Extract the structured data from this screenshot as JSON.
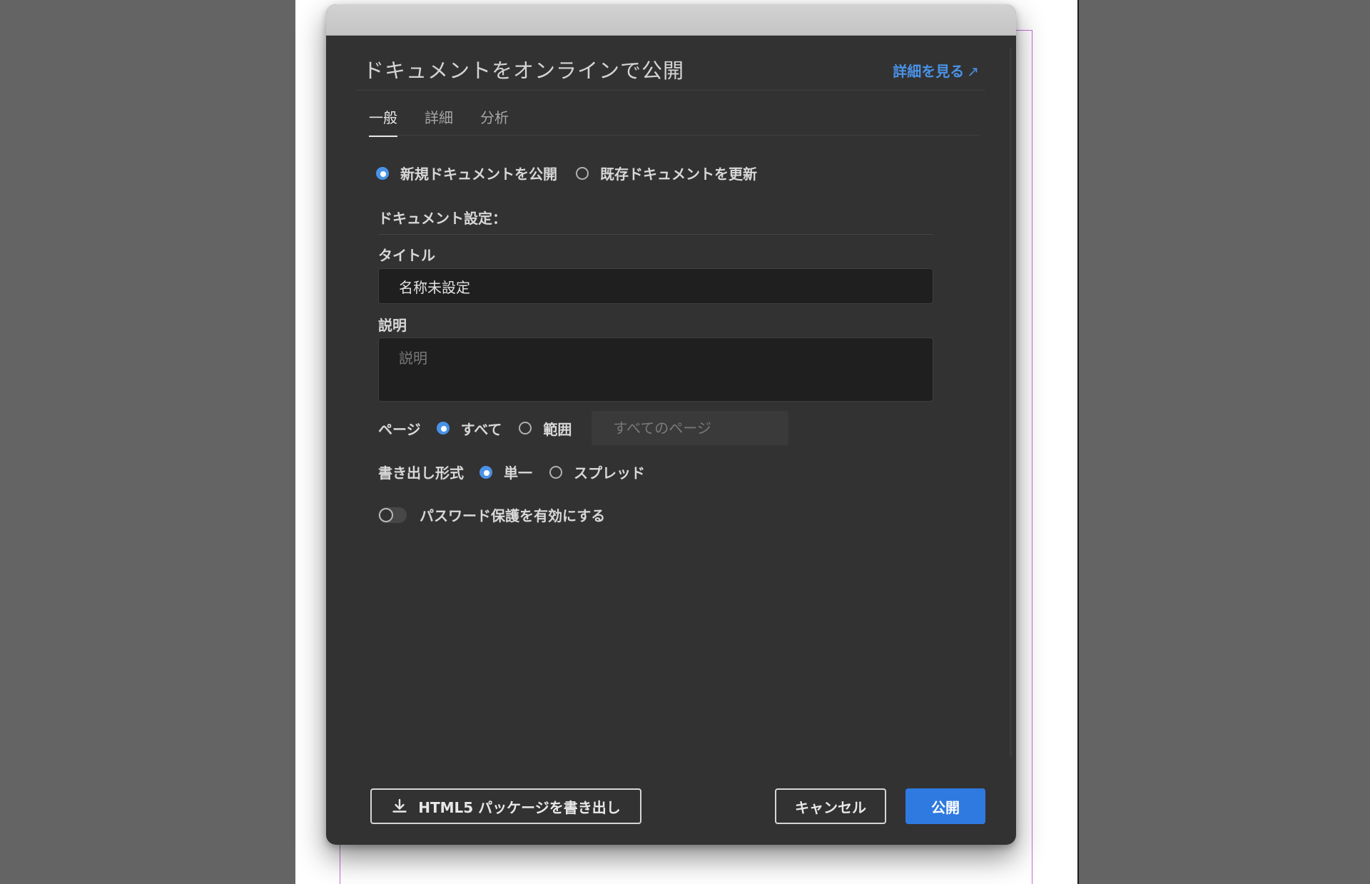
{
  "dialog": {
    "title": "ドキュメントをオンラインで公開",
    "learn_more": "詳細を見る",
    "learn_more_icon": "↗"
  },
  "tabs": [
    {
      "label": "一般",
      "active": true
    },
    {
      "label": "詳細",
      "active": false
    },
    {
      "label": "分析",
      "active": false
    }
  ],
  "publish_mode": {
    "options": [
      {
        "label": "新規ドキュメントを公開",
        "checked": true
      },
      {
        "label": "既存ドキュメントを更新",
        "checked": false
      }
    ]
  },
  "document_settings": {
    "section_label": "ドキュメント設定：",
    "title_label": "タイトル",
    "title_value": "名称未設定",
    "description_label": "説明",
    "description_placeholder": "説明",
    "pages": {
      "label": "ページ",
      "options": [
        {
          "label": "すべて",
          "checked": true
        },
        {
          "label": "範囲",
          "checked": false
        }
      ],
      "range_placeholder": "すべてのページ"
    },
    "export_format": {
      "label": "書き出し形式",
      "options": [
        {
          "label": "単一",
          "checked": true
        },
        {
          "label": "スプレッド",
          "checked": false
        }
      ]
    },
    "password": {
      "label": "パスワード保護を有効にする",
      "enabled": false
    }
  },
  "footer": {
    "export_label": "HTML5 パッケージを書き出し",
    "cancel_label": "キャンセル",
    "publish_label": "公開"
  },
  "colors": {
    "accent": "#2f7ae0",
    "link": "#4a92e6",
    "dialog_bg": "#323232"
  }
}
